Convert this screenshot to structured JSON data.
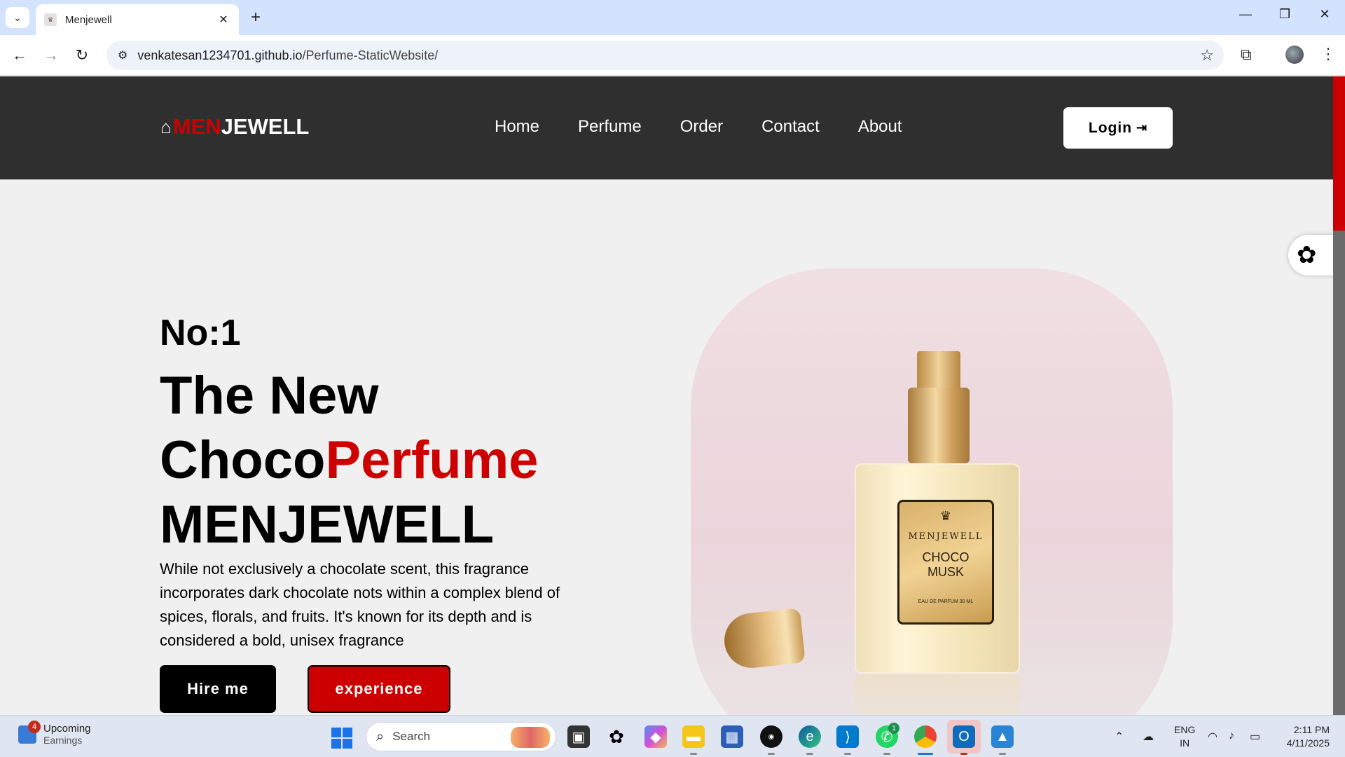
{
  "browser": {
    "tab_title": "Menjewell",
    "favicon": "MENJEWELL",
    "url_host": "venkatesan1234701.github.io",
    "url_path": "/Perfume-StaticWebsite/"
  },
  "site": {
    "logo_part1": "MEN",
    "logo_part2": "JEWELL",
    "nav": [
      "Home",
      "Perfume",
      "Order",
      "Contact",
      "About"
    ],
    "login_label": "Login"
  },
  "hero": {
    "rank": "No:1",
    "line1": "The New",
    "line2_a": "Choco",
    "line2_b": "Perfume",
    "line3": "MENJEWELL",
    "description": "While not exclusively a chocolate scent, this fragrance incorporates dark chocolate nots within a complex blend of spices, florals, and fruits. It's known for its depth and is considered a bold, unisex fragrance",
    "btn_primary": "Hire me",
    "btn_secondary": "experience"
  },
  "product_label": {
    "brand": "MENJEWELL",
    "name_line1": "CHOCO",
    "name_line2": "MUSK",
    "sub": "EAU DE PARFUM 30 ML"
  },
  "taskbar": {
    "widget_badge": "4",
    "widget_title": "Upcoming",
    "widget_sub": "Earnings",
    "search_placeholder": "Search",
    "whatsapp_badge": "1",
    "lang_line1": "ENG",
    "lang_line2": "IN",
    "time": "2:11 PM",
    "date": "4/11/2025"
  },
  "colors": {
    "accent_red": "#cc0000",
    "header_bg": "#2f2f2f",
    "page_bg": "#f0f0f0"
  }
}
